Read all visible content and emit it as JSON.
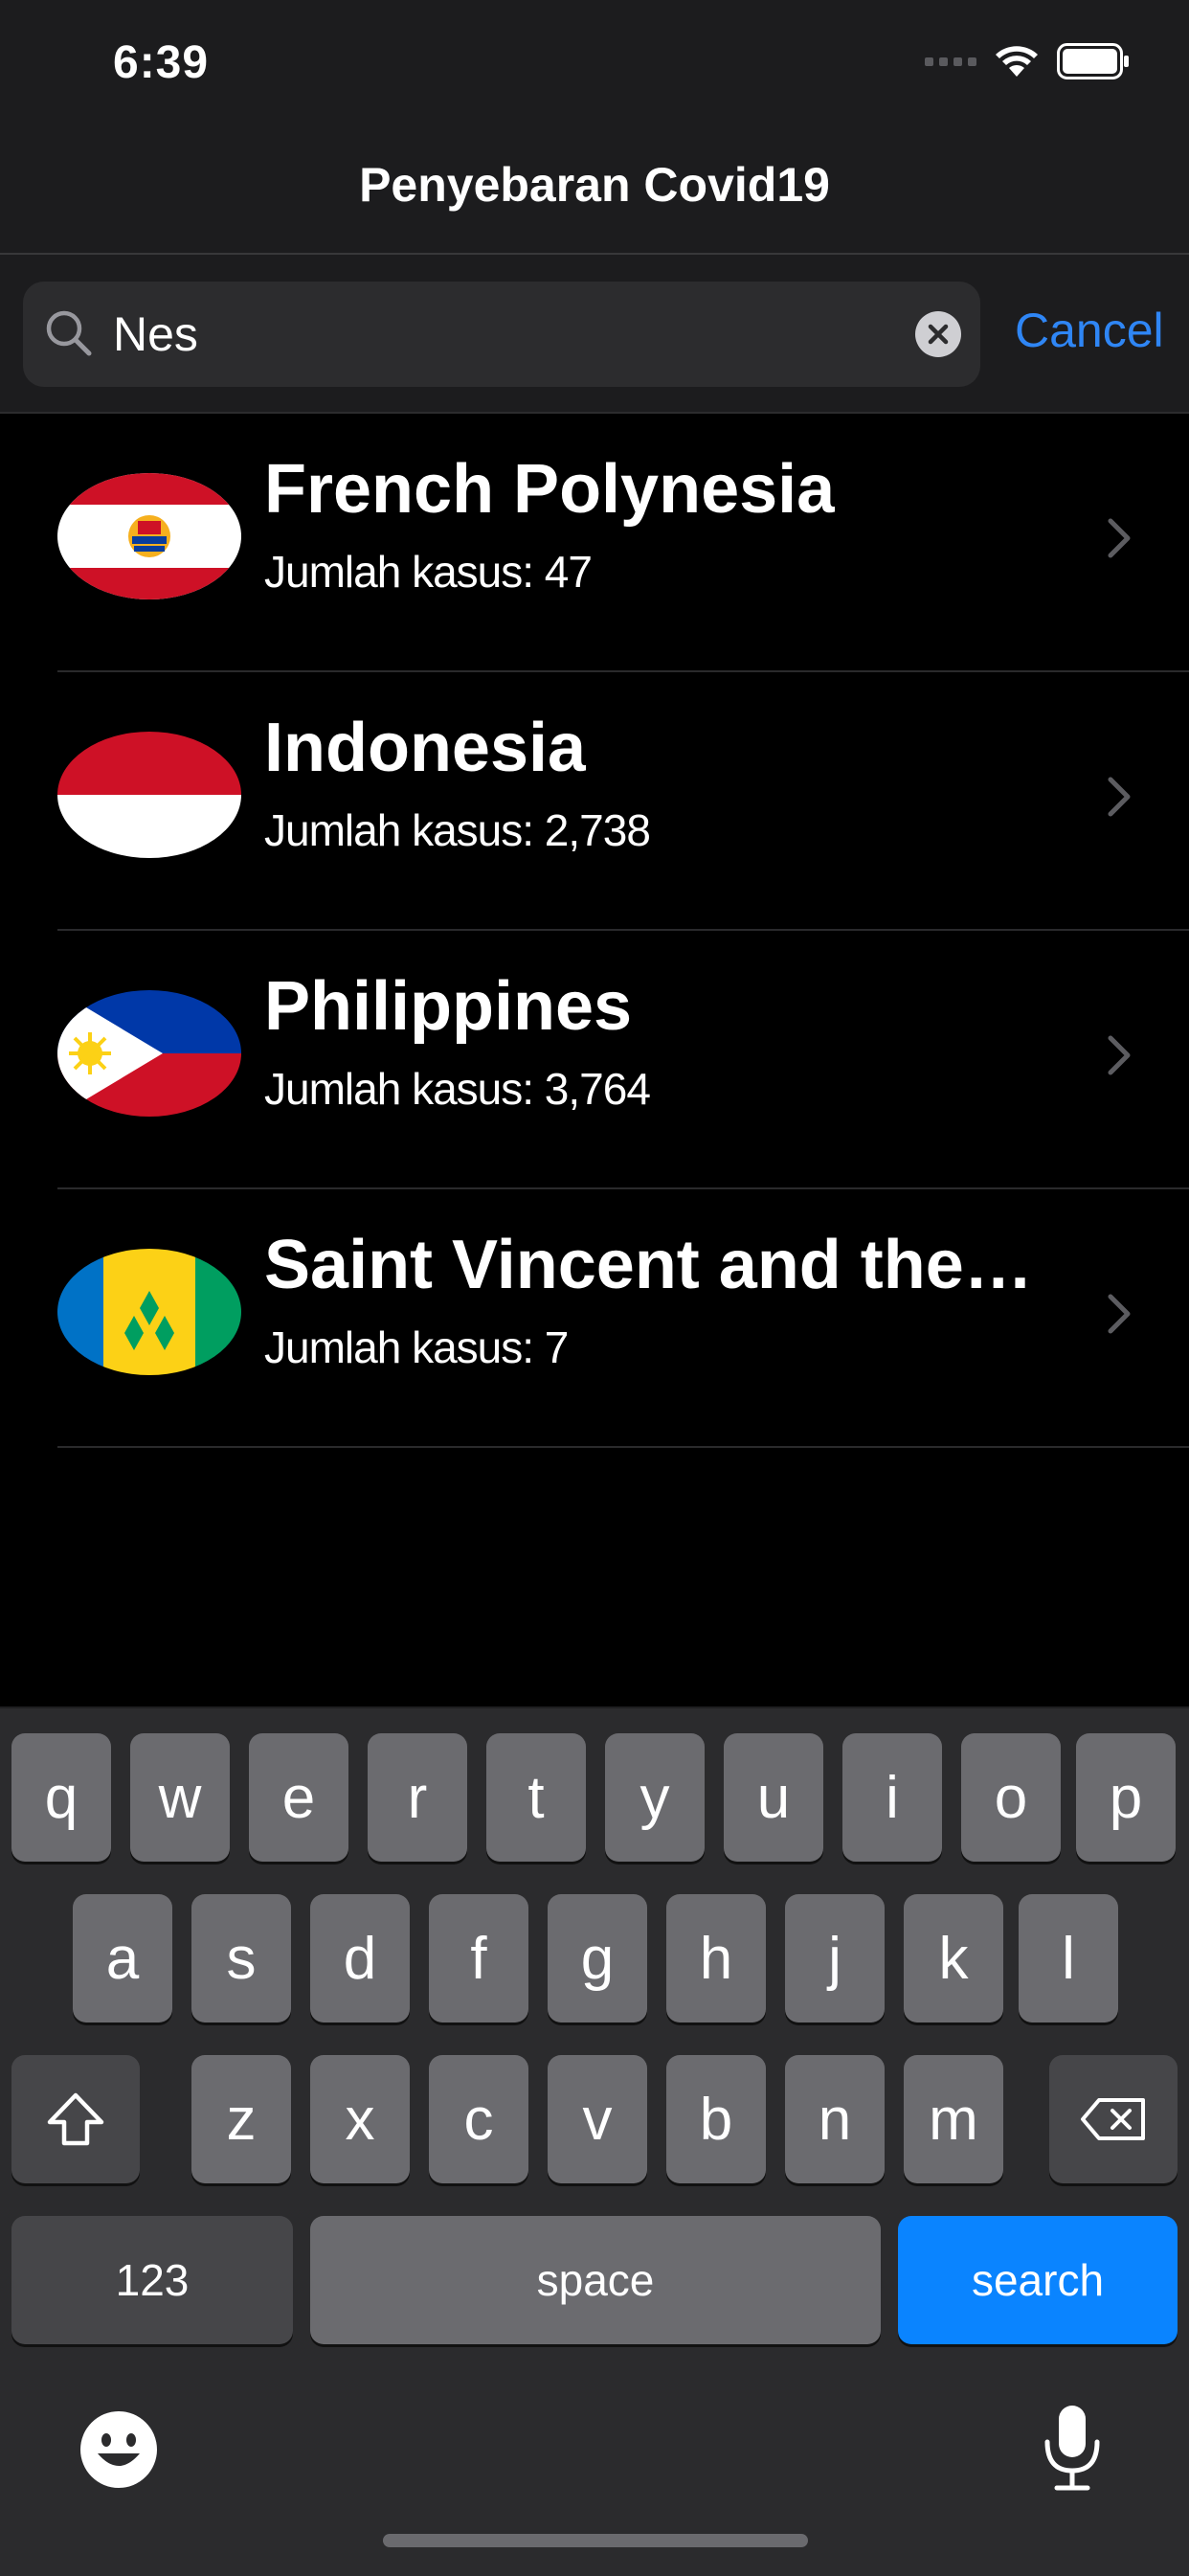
{
  "status_bar": {
    "time": "6:39"
  },
  "nav": {
    "title": "Penyebaran Covid19"
  },
  "search": {
    "value": "Nes",
    "cancel_label": "Cancel"
  },
  "results": [
    {
      "country": "French Polynesia",
      "cases": "Jumlah kasus: 47",
      "flag": "french-polynesia-flag-icon"
    },
    {
      "country": "Indonesia",
      "cases": "Jumlah kasus: 2,738",
      "flag": "indonesia-flag-icon"
    },
    {
      "country": "Philippines",
      "cases": "Jumlah kasus: 3,764",
      "flag": "philippines-flag-icon"
    },
    {
      "country": "Saint Vincent and the…",
      "cases": "Jumlah kasus: 7",
      "flag": "saint-vincent-flag-icon"
    }
  ],
  "keyboard": {
    "row1": [
      "q",
      "w",
      "e",
      "r",
      "t",
      "y",
      "u",
      "i",
      "o",
      "p"
    ],
    "row2": [
      "a",
      "s",
      "d",
      "f",
      "g",
      "h",
      "j",
      "k",
      "l"
    ],
    "row3": [
      "z",
      "x",
      "c",
      "v",
      "b",
      "n",
      "m"
    ],
    "numbers_label": "123",
    "space_label": "space",
    "search_label": "search"
  },
  "colors": {
    "accent": "#2f86f5",
    "search_key": "#0a84ff",
    "background": "#000000",
    "bar": "#1c1c1e"
  }
}
